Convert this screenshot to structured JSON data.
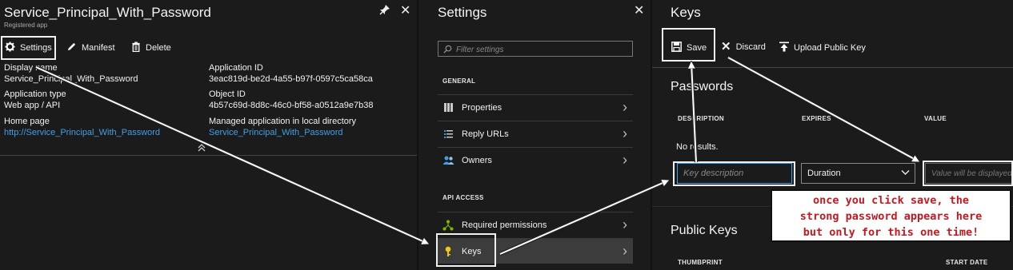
{
  "blade1": {
    "title": "Service_Principal_With_Password",
    "subtitle": "Registered app",
    "commands": {
      "settings": "Settings",
      "manifest": "Manifest",
      "delete": "Delete"
    },
    "essentials": {
      "display_name_label": "Display name",
      "display_name_value": "Service_Principal_With_Password",
      "app_type_label": "Application type",
      "app_type_value": "Web app / API",
      "home_page_label": "Home page",
      "home_page_value": "http://Service_Principal_With_Password",
      "app_id_label": "Application ID",
      "app_id_value": "3eac819d-be2d-4a55-b97f-0597c5ca58ca",
      "object_id_label": "Object ID",
      "object_id_value": "4b57c69d-8d8c-46c0-bf58-a0512a9e7b38",
      "managed_label": "Managed application in local directory",
      "managed_value": "Service_Principal_With_Password"
    }
  },
  "blade2": {
    "title": "Settings",
    "filter_placeholder": "Filter settings",
    "general_header": "GENERAL",
    "api_header": "API ACCESS",
    "items": [
      {
        "label": "Properties",
        "icon": "properties-icon"
      },
      {
        "label": "Reply URLs",
        "icon": "list-icon"
      },
      {
        "label": "Owners",
        "icon": "users-icon"
      },
      {
        "label": "Required permissions",
        "icon": "network-icon"
      },
      {
        "label": "Keys",
        "icon": "key-icon"
      }
    ]
  },
  "blade3": {
    "title": "Keys",
    "commands": {
      "save": "Save",
      "discard": "Discard",
      "upload": "Upload Public Key"
    },
    "passwords_title": "Passwords",
    "columns": {
      "description": "DESCRIPTION",
      "expires": "EXPIRES",
      "value": "VALUE"
    },
    "no_results": "No results.",
    "key_description_placeholder": "Key description",
    "duration_value": "Duration",
    "value_placeholder": "Value will be displayed",
    "public_keys_title": "Public Keys",
    "pk_columns": {
      "thumbprint": "THUMBPRINT",
      "start_date": "START DATE"
    }
  },
  "callout": {
    "text": "once you click save, the\nstrong password appears here\nbut only for this one time!"
  },
  "colors": {
    "accent": "#3fa0e8",
    "callout_text": "#c8171f",
    "background": "#1b1b1b"
  }
}
